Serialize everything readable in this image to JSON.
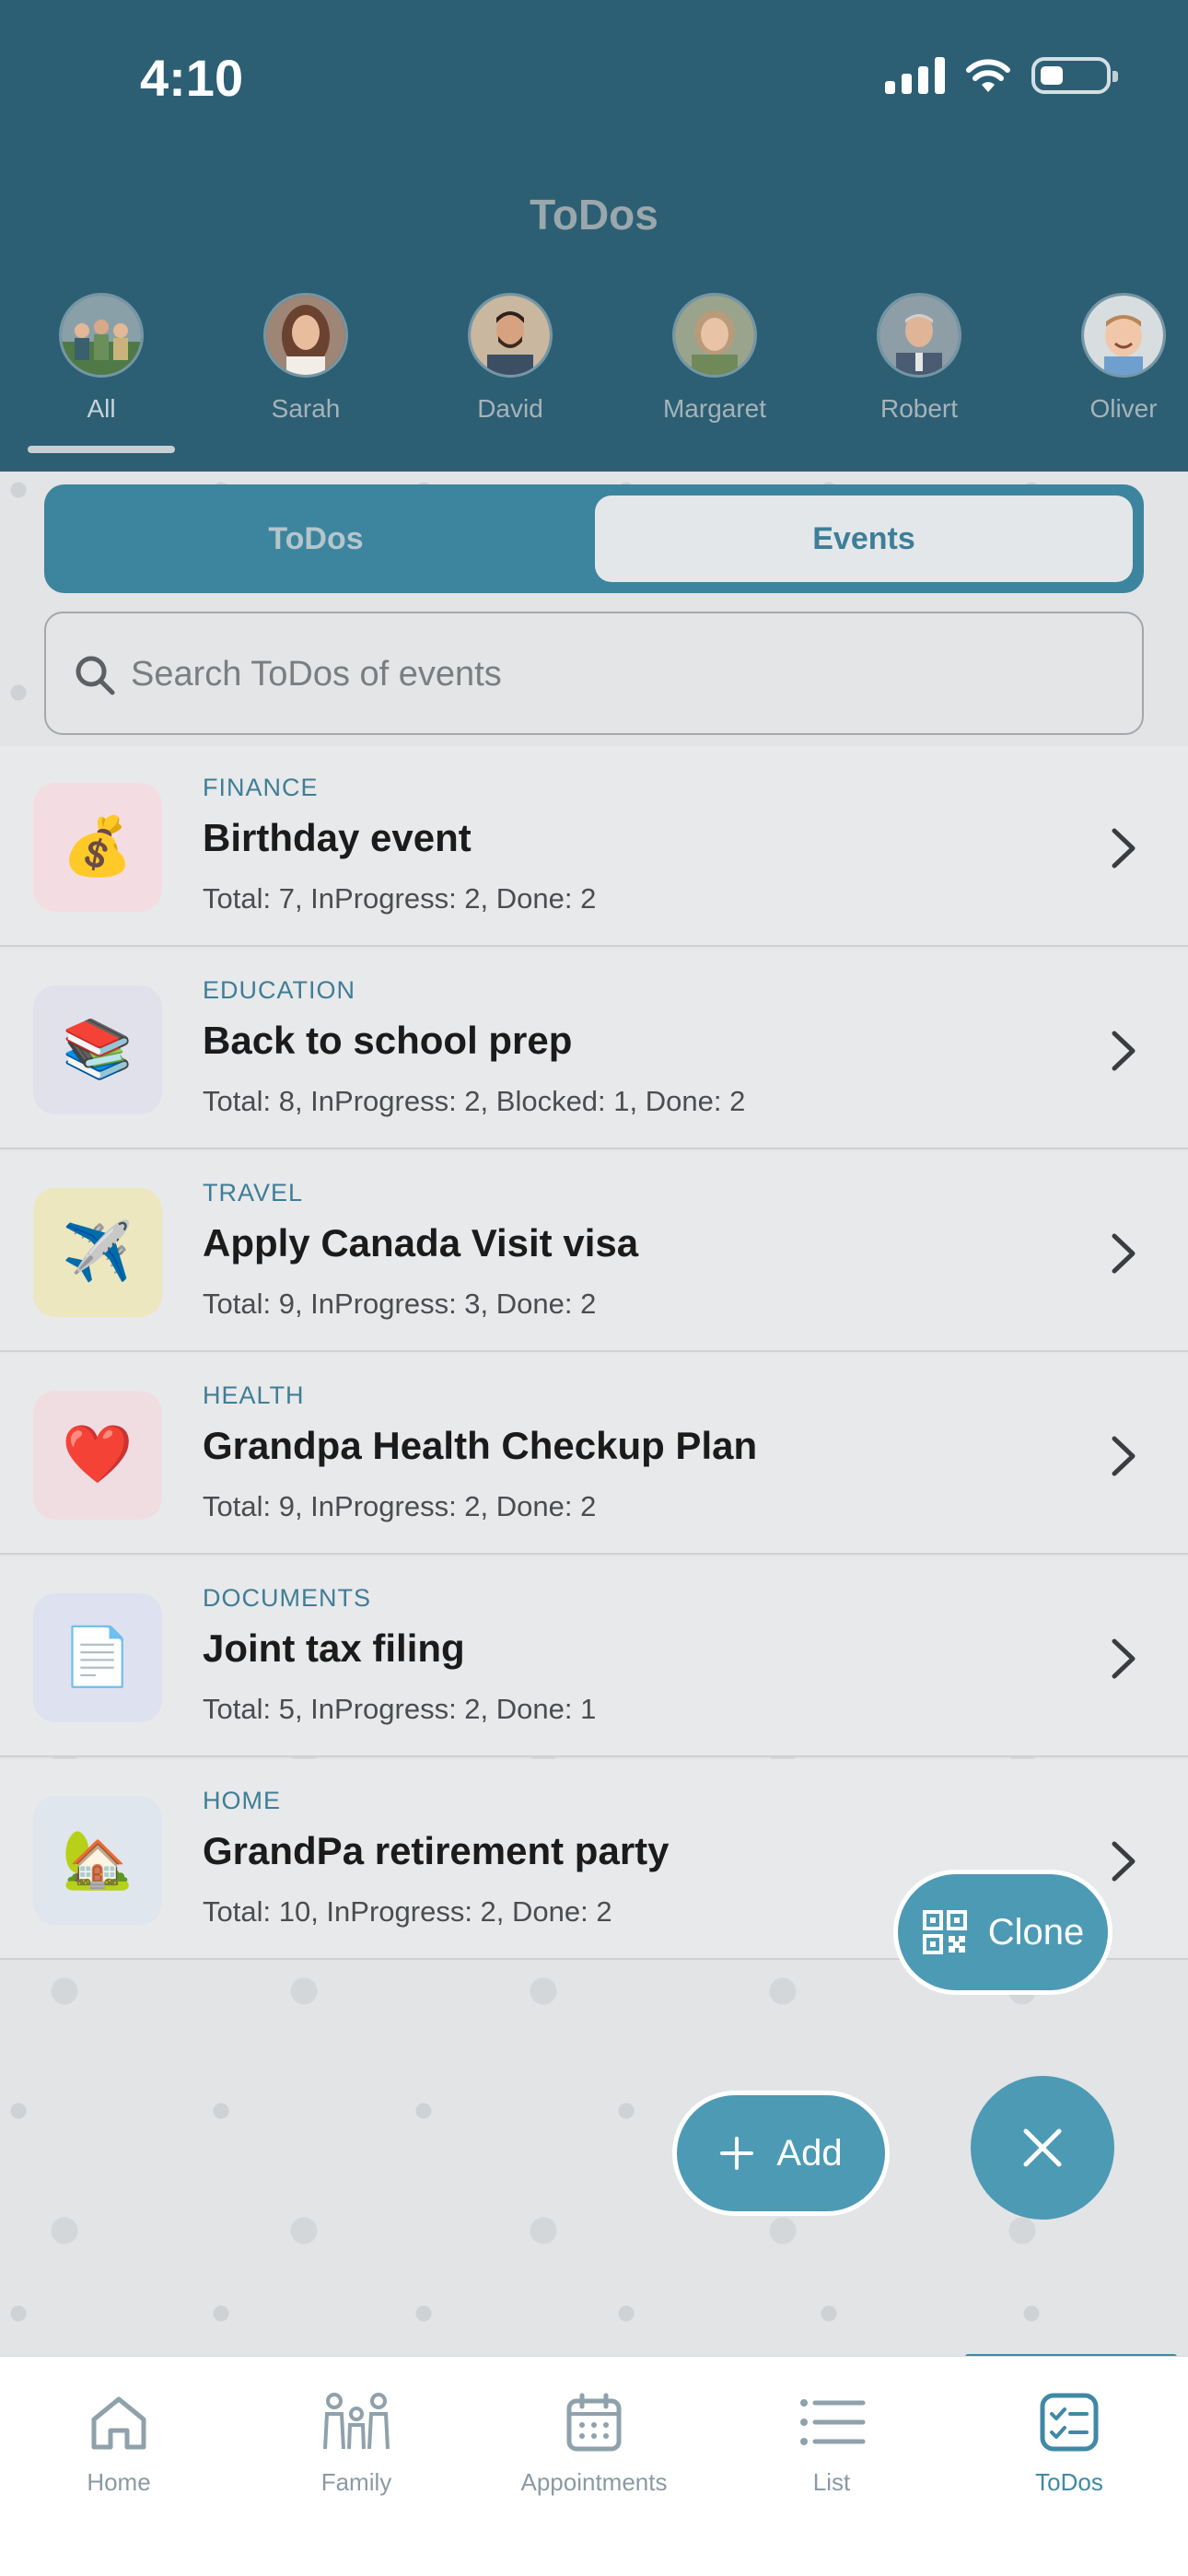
{
  "status_bar": {
    "time": "4:10"
  },
  "header": {
    "title": "ToDos"
  },
  "members": [
    {
      "label": "All",
      "selected": true
    },
    {
      "label": "Sarah",
      "selected": false
    },
    {
      "label": "David",
      "selected": false
    },
    {
      "label": "Margaret",
      "selected": false
    },
    {
      "label": "Robert",
      "selected": false
    },
    {
      "label": "Oliver",
      "selected": false
    }
  ],
  "segment": {
    "todos_label": "ToDos",
    "events_label": "Events",
    "selected": "Events"
  },
  "search": {
    "placeholder": "Search ToDos of events",
    "value": ""
  },
  "events": [
    {
      "category": "FINANCE",
      "title": "Birthday event",
      "stats": "Total: 7, InProgress: 2, Done: 2",
      "icon": "money-bag-icon",
      "glyph": "💰",
      "tint": "#f3dde3"
    },
    {
      "category": "EDUCATION",
      "title": "Back to school prep",
      "stats": "Total: 8, InProgress: 2, Blocked: 1, Done: 2",
      "icon": "books-icon",
      "glyph": "📚",
      "tint": "#e1e1ec"
    },
    {
      "category": "TRAVEL",
      "title": "Apply Canada Visit visa",
      "stats": "Total: 9, InProgress: 3, Done: 2",
      "icon": "airplane-icon",
      "glyph": "✈️",
      "tint": "#ece7bf"
    },
    {
      "category": "HEALTH",
      "title": "Grandpa Health Checkup Plan",
      "stats": "Total: 9, InProgress: 2, Done: 2",
      "icon": "heart-icon",
      "glyph": "❤️",
      "tint": "#f0dde2"
    },
    {
      "category": "DOCUMENTS",
      "title": "Joint tax filing",
      "stats": "Total: 5, InProgress: 2, Done: 1",
      "icon": "document-icon",
      "glyph": "📄",
      "tint": "#dde1f0"
    },
    {
      "category": "HOME",
      "title": "GrandPa retirement party",
      "stats": "Total: 10, InProgress: 2, Done: 2",
      "icon": "house-icon",
      "glyph": "🏡",
      "tint": "#dfe6ee"
    }
  ],
  "actions": {
    "clone_label": "Clone",
    "add_label": "Add"
  },
  "tabbar": [
    {
      "label": "Home",
      "icon": "home-icon",
      "active": false
    },
    {
      "label": "Family",
      "icon": "family-icon",
      "active": false
    },
    {
      "label": "Appointments",
      "icon": "calendar-icon",
      "active": false
    },
    {
      "label": "List",
      "icon": "list-icon",
      "active": false
    },
    {
      "label": "ToDos",
      "icon": "todos-icon",
      "active": true
    }
  ],
  "colors": {
    "header": "#2c5f74",
    "accent": "#4d9ab5",
    "category": "#3f7d97"
  }
}
